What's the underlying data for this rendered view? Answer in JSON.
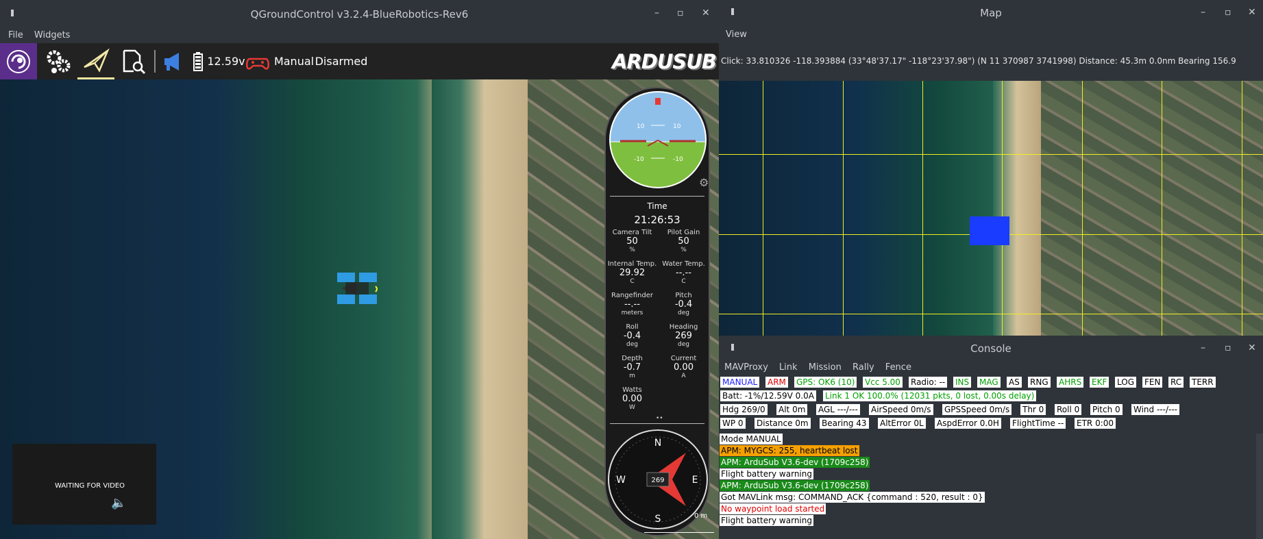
{
  "qgc": {
    "title": "QGroundControl v3.2.4-BlueRobotics-Rev6",
    "menu": [
      "File",
      "Widgets"
    ],
    "toolbar": {
      "battery_voltage": "12.59v",
      "mode": "Manual",
      "arm_state": "Disarmed",
      "logo": "ARDUSUB"
    },
    "attitude": {
      "pitch_marks": [
        "10",
        "10",
        "-10",
        "-10"
      ]
    },
    "time_label": "Time",
    "time_value": "21:26:53",
    "values": [
      {
        "label": "Camera Tilt",
        "value": "50",
        "unit": "%"
      },
      {
        "label": "Pilot Gain",
        "value": "50",
        "unit": "%"
      },
      {
        "label": "Internal Temp.",
        "value": "29.92",
        "unit": "C"
      },
      {
        "label": "Water Temp.",
        "value": "--.--",
        "unit": "C"
      },
      {
        "label": "Rangefinder",
        "value": "--.--",
        "unit": "meters"
      },
      {
        "label": "Pitch",
        "value": "-0.4",
        "unit": "deg"
      },
      {
        "label": "Roll",
        "value": "-0.4",
        "unit": "deg"
      },
      {
        "label": "Heading",
        "value": "269",
        "unit": "deg"
      },
      {
        "label": "Depth",
        "value": "-0.7",
        "unit": "m"
      },
      {
        "label": "Current",
        "value": "0.00",
        "unit": "A"
      },
      {
        "label": "Watts",
        "value": "0.00",
        "unit": "W"
      }
    ],
    "compass": {
      "n": "N",
      "s": "S",
      "e": "E",
      "w": "W",
      "heading": "269"
    },
    "scale_label": "0 m",
    "video": {
      "status": "WAITING FOR VIDEO"
    }
  },
  "map_window": {
    "title": "Map",
    "menu": [
      "View"
    ],
    "info": "Click: 33.810326 -118.393884 (33°48'37.17\" -118°23'37.98\") (N 11 370987 3741998)  Distance: 45.3m 0.0nm Bearing 156.9"
  },
  "console": {
    "title": "Console",
    "menu": [
      "MAVProxy",
      "Link",
      "Mission",
      "Rally",
      "Fence"
    ],
    "status_row1": [
      {
        "text": "MANUAL",
        "color": "#1a1aff"
      },
      {
        "text": "ARM",
        "color": "#e00000"
      },
      {
        "text": "GPS: OK6 (10)",
        "color": "#00a000"
      },
      {
        "text": "Vcc 5.00",
        "color": "#00a000"
      },
      {
        "text": "Radio: --",
        "color": "#000000"
      },
      {
        "text": "INS",
        "color": "#00a000"
      },
      {
        "text": "MAG",
        "color": "#00a000"
      },
      {
        "text": "AS",
        "color": "#000000"
      },
      {
        "text": "RNG",
        "color": "#000000"
      },
      {
        "text": "AHRS",
        "color": "#00a000"
      },
      {
        "text": "EKF",
        "color": "#00a000"
      },
      {
        "text": "LOG",
        "color": "#000000"
      },
      {
        "text": "FEN",
        "color": "#000000"
      },
      {
        "text": "RC",
        "color": "#000000"
      },
      {
        "text": "TERR",
        "color": "#000000"
      }
    ],
    "status_row2": [
      {
        "text": "Batt: -1%/12.59V 0.0A",
        "color": "#000000"
      },
      {
        "text": "Link 1 OK 100.0% (12031 pkts, 0 lost, 0.00s delay)",
        "color": "#00a000"
      }
    ],
    "status_row3": [
      "Hdg 269/0",
      "Alt 0m",
      "AGL ---/---",
      "AirSpeed 0m/s",
      "GPSSpeed 0m/s",
      "Thr 0",
      "Roll 0",
      "Pitch 0",
      "Wind ---/---"
    ],
    "status_row4": [
      "WP 0",
      "Distance 0m",
      "Bearing 43",
      "AltError 0L",
      "AspdError 0.0H",
      "FlightTime --",
      "ETR 0:00"
    ],
    "messages": [
      {
        "text": "Mode MANUAL",
        "bg": "#ffffff",
        "fg": "#000000"
      },
      {
        "text": "APM: MYGCS: 255, heartbeat lost",
        "bg": "#f5a000",
        "fg": "#000000"
      },
      {
        "text": "APM: ArduSub V3.6-dev (1709c258)",
        "bg": "#1a8a1a",
        "fg": "#ffffff"
      },
      {
        "text": "Flight battery warning",
        "bg": "#ffffff",
        "fg": "#000000"
      },
      {
        "text": "APM: ArduSub V3.6-dev (1709c258)",
        "bg": "#1a8a1a",
        "fg": "#ffffff"
      },
      {
        "text": "Got MAVLink msg: COMMAND_ACK {command : 520, result : 0}",
        "bg": "#ffffff",
        "fg": "#000000"
      },
      {
        "text": "No waypoint load started",
        "bg": "#ffffff",
        "fg": "#e00000"
      },
      {
        "text": "Flight battery warning",
        "bg": "#ffffff",
        "fg": "#000000"
      }
    ]
  }
}
